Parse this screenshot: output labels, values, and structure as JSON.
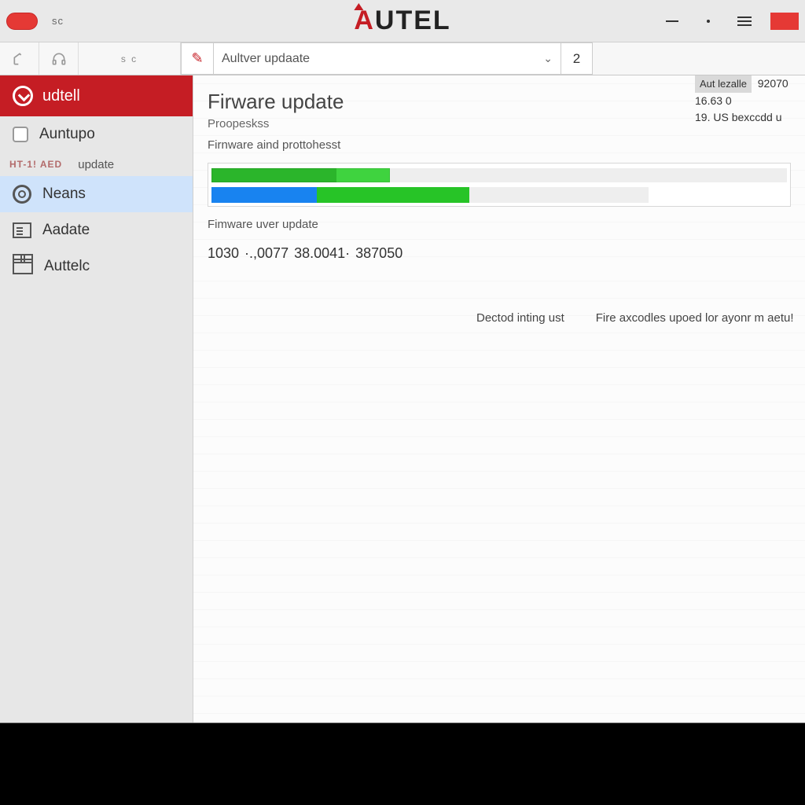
{
  "titlebar": {
    "left_code": "sc",
    "brand_red": "A",
    "brand_rest": "UTEL"
  },
  "toolbar": {
    "code": "s c",
    "address": "Aultver updaate",
    "number": "2"
  },
  "sidebar": {
    "brand": "udtell",
    "items": [
      {
        "label": "Auntupo"
      },
      {
        "sub_a": "HT-1! AED",
        "sub_b": "update"
      },
      {
        "label": "Neans"
      },
      {
        "label": "Aadate"
      },
      {
        "label": "Auttelc"
      }
    ]
  },
  "main": {
    "title": "Firware update",
    "subtitle": "Proopeskss",
    "line2": "Firnware aind prottohesst",
    "caption": "Fimware uver update",
    "numbers": "1030 ·.,0077 38.0041· 387050",
    "status_a": "Dectod inting ust",
    "status_b": "Fire axcodles upoed lor ayonr m aetu!"
  },
  "info": {
    "tag": "Aut lezalle",
    "code": "92070",
    "line2": "16.63 0",
    "line3": "19. US bexccdd u"
  }
}
